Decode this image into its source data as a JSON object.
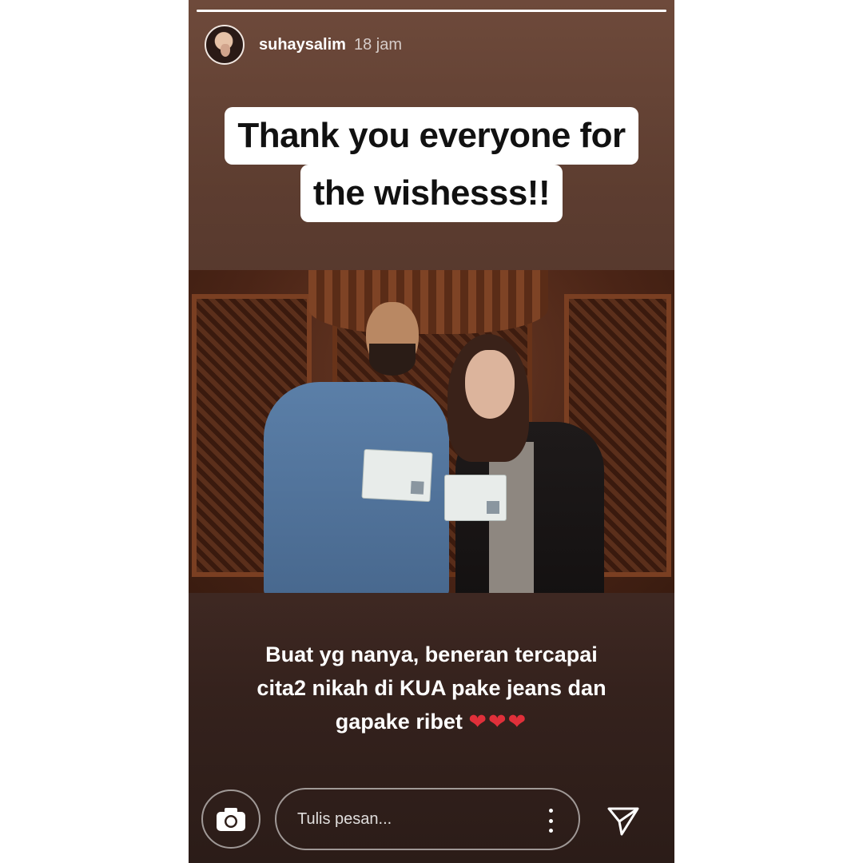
{
  "story": {
    "progress_fraction": 1.0,
    "username": "suhaysalim",
    "timestamp": "18 jam",
    "caption_top": [
      "Thank you everyone for",
      "the wishesss!!"
    ],
    "caption_bottom_lines": [
      "Buat yg nanya, beneran tercapai",
      "cita2 nikah di KUA pake jeans dan",
      "gapake ribet"
    ],
    "caption_bottom_emoji": "❤❤❤",
    "photo_icon": "photo"
  },
  "footer": {
    "camera_icon": "camera-icon",
    "message_placeholder": "Tulis pesan...",
    "more_icon": "more-vertical-icon",
    "send_icon": "send-icon"
  },
  "colors": {
    "story_bg_top": "#6e4a3b",
    "story_bg_bottom": "#2b1c18",
    "heart": "#e0303a"
  }
}
